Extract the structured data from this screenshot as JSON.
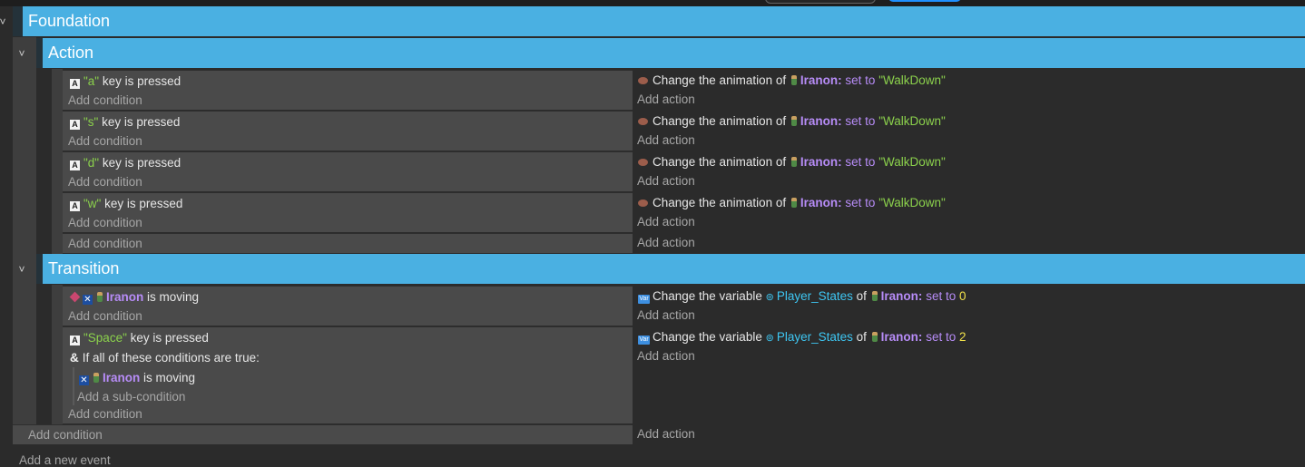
{
  "groups": {
    "foundation": "Foundation",
    "action": "Action",
    "transition": "Transition"
  },
  "common": {
    "add_condition": "Add condition",
    "add_action": "Add action",
    "add_sub_condition": "Add a sub-condition",
    "add_new_event": "Add a new event"
  },
  "action_events": [
    {
      "key": "\"a\"",
      "key_suffix": "key is pressed",
      "act_text": "Change the animation of",
      "act_obj": "Iranon:",
      "act_kw": "set to",
      "act_value": "\"WalkDown\""
    },
    {
      "key": "\"s\"",
      "key_suffix": "key is pressed",
      "act_text": "Change the animation of",
      "act_obj": "Iranon:",
      "act_kw": "set to",
      "act_value": "\"WalkDown\""
    },
    {
      "key": "\"d\"",
      "key_suffix": "key is pressed",
      "act_text": "Change the animation of",
      "act_obj": "Iranon:",
      "act_kw": "set to",
      "act_value": "\"WalkDown\""
    },
    {
      "key": "\"w\"",
      "key_suffix": "key is pressed",
      "act_text": "Change the animation of",
      "act_obj": "Iranon:",
      "act_kw": "set to",
      "act_value": "\"WalkDown\""
    }
  ],
  "transition_events": [
    {
      "cond_obj": "Iranon",
      "cond_suffix": "is moving",
      "act_text": "Change the variable",
      "act_var": "Player_States",
      "act_of": "of",
      "act_obj": "Iranon:",
      "act_kw": "set to",
      "act_value": "0"
    },
    {
      "key": "\"Space\"",
      "key_suffix": "key is pressed",
      "all_true": "If all of these conditions are true:",
      "sub_obj": "Iranon",
      "sub_suffix": "is moving",
      "act_text": "Change the variable",
      "act_var": "Player_States",
      "act_of": "of",
      "act_obj": "Iranon:",
      "act_kw": "set to",
      "act_value": "2"
    }
  ],
  "icons": {
    "chevron": "chevron-down-icon",
    "key": "keyboard-key-icon",
    "sprite": "iranon-sprite-icon",
    "animation": "animation-icon",
    "movement": "movement-icon",
    "variable": "variable-icon"
  },
  "colors": {
    "group_header": "#4ab0e2",
    "string_literal": "#8bd14c",
    "object_name": "#b78cf7",
    "variable_name": "#3ec7f3",
    "number": "#f0e04a"
  }
}
